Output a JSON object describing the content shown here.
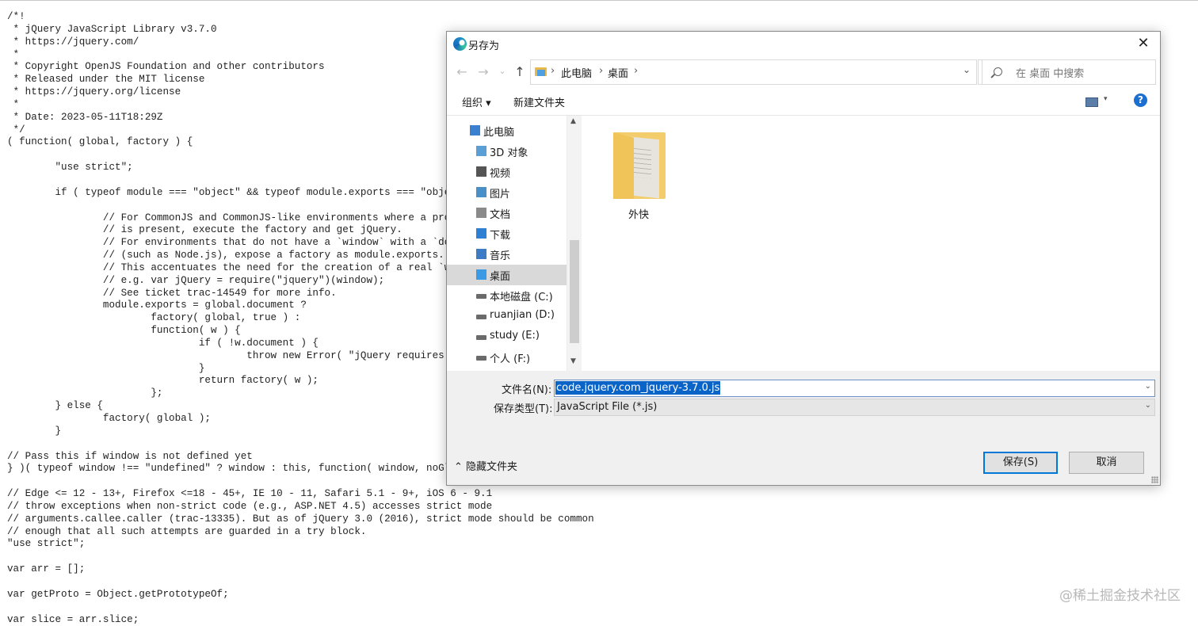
{
  "code_lines": [
    "/*!",
    " * jQuery JavaScript Library v3.7.0",
    " * https://jquery.com/",
    " *",
    " * Copyright OpenJS Foundation and other contributors",
    " * Released under the MIT license",
    " * https://jquery.org/license",
    " *",
    " * Date: 2023-05-11T18:29Z",
    " */",
    "( function( global, factory ) {",
    "",
    "        \"use strict\";",
    "",
    "        if ( typeof module === \"object\" && typeof module.exports === \"object\" )",
    "",
    "                // For CommonJS and CommonJS-like environments where a proper `",
    "                // is present, execute the factory and get jQuery.",
    "                // For environments that do not have a `window` with a `documen",
    "                // (such as Node.js), expose a factory as module.exports.",
    "                // This accentuates the need for the creation of a real `window",
    "                // e.g. var jQuery = require(\"jquery\")(window);",
    "                // See ticket trac-14549 for more info.",
    "                module.exports = global.document ?",
    "                        factory( global, true ) :",
    "                        function( w ) {",
    "                                if ( !w.document ) {",
    "                                        throw new Error( \"jQuery requires a win",
    "                                }",
    "                                return factory( w );",
    "                        };",
    "        } else {",
    "                factory( global );",
    "        }",
    "",
    "// Pass this if window is not defined yet",
    "} )( typeof window !== \"undefined\" ? window : this, function( window, noGlobal",
    "",
    "// Edge <= 12 - 13+, Firefox <=18 - 45+, IE 10 - 11, Safari 5.1 - 9+, iOS 6 - 9.1",
    "// throw exceptions when non-strict code (e.g., ASP.NET 4.5) accesses strict mode",
    "// arguments.callee.caller (trac-13335). But as of jQuery 3.0 (2016), strict mode should be common",
    "// enough that all such attempts are guarded in a try block.",
    "\"use strict\";",
    "",
    "var arr = [];",
    "",
    "var getProto = Object.getPrototypeOf;",
    "",
    "var slice = arr.slice;"
  ],
  "watermark": "@稀土掘金技术社区",
  "dialog": {
    "title": "另存为",
    "close": "✕",
    "nav": {
      "back": "←",
      "forward": "→",
      "recent": "⌄",
      "up": "↑",
      "path": [
        "此电脑",
        "桌面"
      ],
      "sep": "›",
      "dropdown": "⌄",
      "refresh": "↻",
      "search_placeholder": "在 桌面 中搜索"
    },
    "toolbar": {
      "organize": "组织 ▾",
      "new_folder": "新建文件夹",
      "view_dd": "▾",
      "help": "?"
    },
    "tree": {
      "items": [
        {
          "label": "此电脑",
          "icon": "computer-icon",
          "color": "#3b7fd0"
        },
        {
          "label": "3D 对象",
          "icon": "3d-objects-icon",
          "color": "#5aa0d6"
        },
        {
          "label": "视频",
          "icon": "videos-icon",
          "color": "#555"
        },
        {
          "label": "图片",
          "icon": "pictures-icon",
          "color": "#4a90c8"
        },
        {
          "label": "文档",
          "icon": "documents-icon",
          "color": "#8a8a8a"
        },
        {
          "label": "下载",
          "icon": "downloads-icon",
          "color": "#2f7fd2"
        },
        {
          "label": "音乐",
          "icon": "music-icon",
          "color": "#3d7bc4"
        },
        {
          "label": "桌面",
          "icon": "desktop-icon",
          "color": "#3a9be4"
        },
        {
          "label": "本地磁盘 (C:)",
          "icon": "drive-c-icon",
          "color": "#6a6a6a"
        },
        {
          "label": "ruanjian (D:)",
          "icon": "drive-icon",
          "color": "#6a6a6a"
        },
        {
          "label": "study (E:)",
          "icon": "drive-icon",
          "color": "#6a6a6a"
        },
        {
          "label": "个人 (F:)",
          "icon": "drive-icon",
          "color": "#6a6a6a"
        }
      ],
      "selected": "桌面",
      "scroll_up": "▲",
      "scroll_down": "▼"
    },
    "files": [
      {
        "label": "外快",
        "icon": "folder-icon"
      }
    ],
    "form": {
      "filename_label": "文件名(N):",
      "filename_value": "code.jquery.com_jquery-3.7.0.js",
      "filetype_label": "保存类型(T):",
      "filetype_value": "JavaScript File (*.js)",
      "dd": "⌄"
    },
    "hide_folders": "⌃ 隐藏文件夹",
    "save": "保存(S)",
    "cancel": "取消"
  }
}
